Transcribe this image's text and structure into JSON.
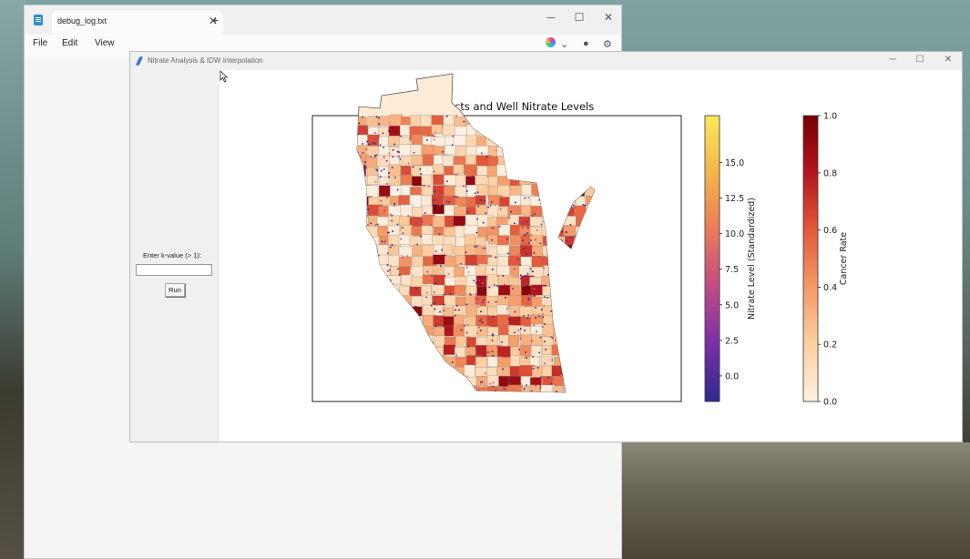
{
  "notepad": {
    "tab_title": "debug_log.txt",
    "menu": [
      "File",
      "Edit",
      "View"
    ],
    "icons": [
      "notepad-app-icon",
      "close-icon",
      "plus-icon",
      "minimize-icon",
      "maximize-icon",
      "copilot-icon",
      "profile-icon",
      "gear-icon"
    ]
  },
  "tk_window": {
    "title": "Nitrate Analysis & IDW Interpolation",
    "k_label": "Enter k-value (> 1):",
    "k_input_value": "",
    "run_label": "Run"
  },
  "chart_data": {
    "type": "map",
    "title": "Cancer Tracts and Well Nitrate Levels",
    "colorbars": [
      {
        "name": "nitrate",
        "label": "Nitrate Level (Standardized)",
        "ticks": [
          "0.0",
          "2.5",
          "5.0",
          "7.5",
          "10.0",
          "12.5",
          "15.0"
        ],
        "tick_values": [
          0.0,
          2.5,
          5.0,
          7.5,
          10.0,
          12.5,
          15.0
        ],
        "range": [
          -1.8,
          18.3
        ],
        "colormap": [
          "#2e2a8e",
          "#7a2fa8",
          "#c14b85",
          "#ea7a5a",
          "#f5b54a",
          "#fbe85a"
        ]
      },
      {
        "name": "cancer",
        "label": "Cancer Rate",
        "ticks": [
          "0.0",
          "0.2",
          "0.4",
          "0.6",
          "0.8",
          "1.0"
        ],
        "tick_values": [
          0.0,
          0.2,
          0.4,
          0.6,
          0.8,
          1.0
        ],
        "range": [
          0.0,
          1.0
        ],
        "colormap": [
          "#fdf0e2",
          "#fdd0a2",
          "#f49a66",
          "#e35a3a",
          "#b4141c",
          "#7a0000"
        ]
      }
    ],
    "grid": false
  }
}
